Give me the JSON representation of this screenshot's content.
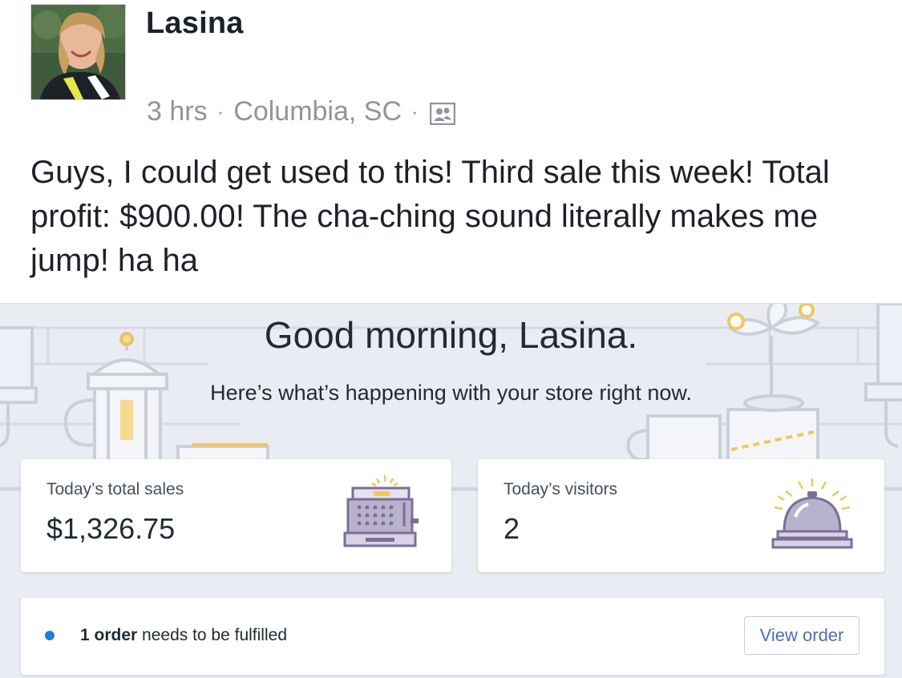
{
  "post": {
    "author": "Lasina",
    "time": "3 hrs",
    "location": "Columbia, SC",
    "separator": "·",
    "audience_icon": "friends-icon",
    "text": "Guys, I could get used to this! Third sale this week! Total profit: $900.00! The cha-ching sound literally makes me jump! ha ha"
  },
  "dashboard": {
    "greeting": "Good morning, Lasina.",
    "subgreeting": "Here’s what’s happening with your store right now.",
    "sales_card": {
      "label": "Today’s total sales",
      "value": "$1,326.75",
      "icon": "cash-register-icon"
    },
    "visitors_card": {
      "label": "Today’s visitors",
      "value": "2",
      "icon": "service-bell-icon"
    },
    "orders_card": {
      "count_text": "1 order",
      "rest_text": " needs to be fulfilled",
      "button_label": "View order",
      "status_color": "#1a7fd9"
    }
  }
}
